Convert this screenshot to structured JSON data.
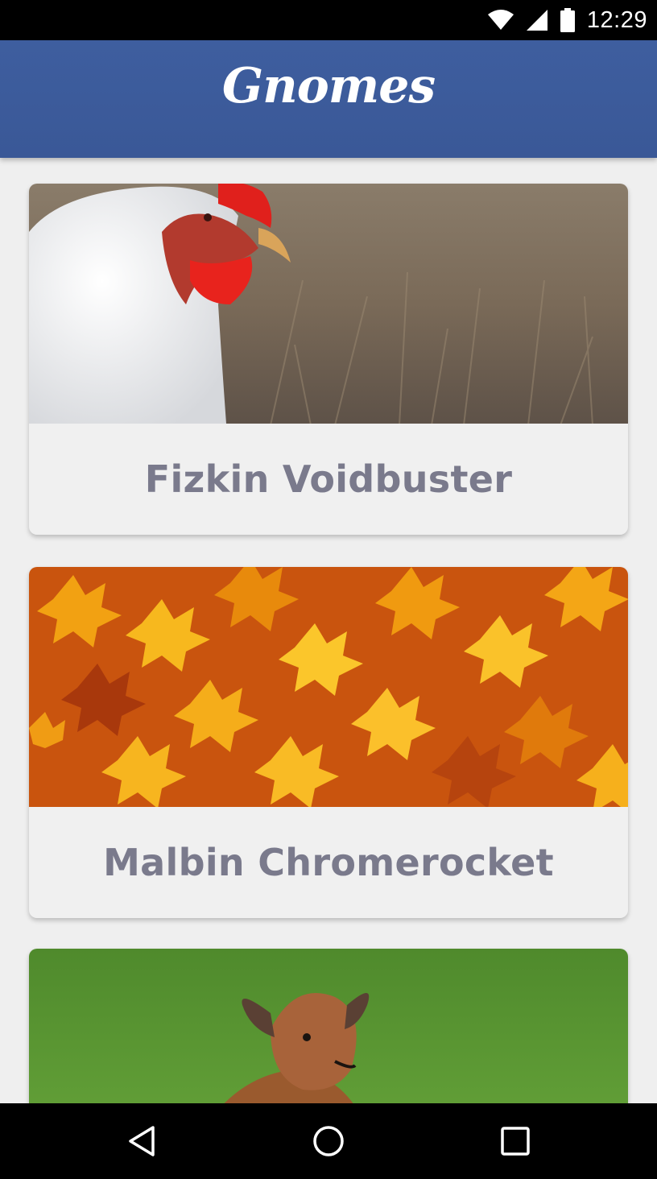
{
  "status_bar": {
    "time": "12:29",
    "icons": [
      "wifi-icon",
      "signal-icon",
      "battery-icon"
    ]
  },
  "app_bar": {
    "title": "Gnomes",
    "color": "#3b5a9a"
  },
  "gnomes": [
    {
      "name": "Fizkin Voidbuster",
      "image": "white chicken with red comb"
    },
    {
      "name": "Malbin Chromerocket",
      "image": "orange autumn maple leaves"
    },
    {
      "name": "",
      "image": "young deer resting on grass"
    }
  ],
  "nav_bar": {
    "buttons": [
      "back-icon",
      "home-icon",
      "recents-icon"
    ]
  },
  "colors": {
    "background": "#efefef",
    "card_text": "#7a7a8c"
  }
}
